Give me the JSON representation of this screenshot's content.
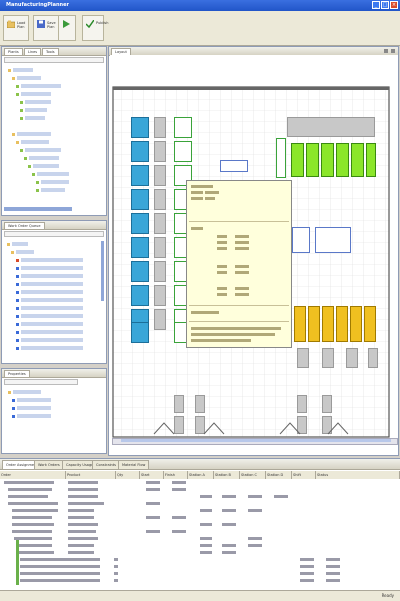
{
  "app": {
    "title": "ManufacturingPlanner",
    "window_buttons": [
      "_",
      "□",
      "×"
    ]
  },
  "toolbar": {
    "buttons": [
      {
        "label": "Load Plan",
        "icon": "open-icon"
      },
      {
        "label": "Save Plan",
        "icon": "save-icon"
      },
      {
        "label": "Schedule",
        "icon": "play-icon"
      },
      {
        "label": "Publish",
        "icon": "check-icon"
      }
    ]
  },
  "left_top": {
    "tabs": [
      "Plants",
      "Lines",
      "Tools"
    ]
  },
  "left_mid": {
    "tabs": [
      "Work Order Queue"
    ]
  },
  "left_bot": {
    "tabs": [
      "Properties"
    ]
  },
  "canvas": {
    "tab": "Layout"
  },
  "bottom": {
    "tabs": [
      "Order Assignments",
      "Work Orders",
      "Capacity Usage",
      "Constraints",
      "Material Flow"
    ],
    "columns": [
      "Order",
      "Product",
      "Qty",
      "Start",
      "Finish",
      "Station A",
      "Station B",
      "Station C",
      "Station D",
      "Shift",
      "Status"
    ]
  },
  "status": {
    "text": "Ready"
  },
  "colors": {
    "titlebar": "#2155c8",
    "blue_station": "#3aa6d8",
    "green_station": "#8be62a",
    "yellow_station": "#f0c020",
    "tooltip": "#ffffdc"
  }
}
